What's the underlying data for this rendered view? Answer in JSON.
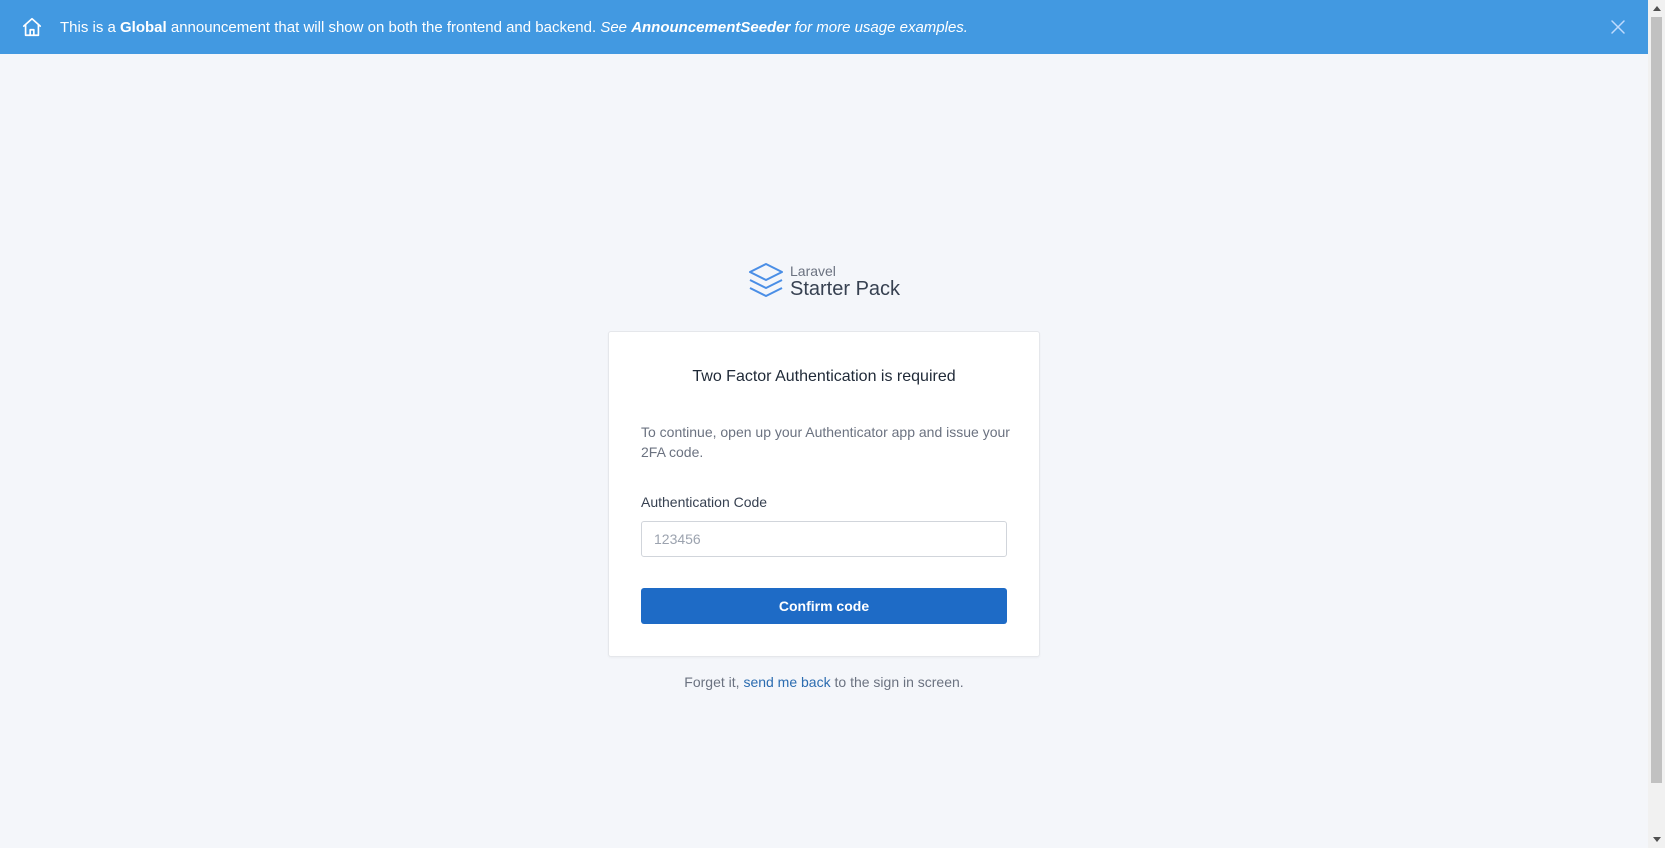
{
  "announcement": {
    "prefix": "This is a ",
    "bold_word": "Global",
    "middle": " announcement that will show on both the frontend and backend. ",
    "italic_prefix": "See ",
    "italic_bold": "AnnouncementSeeder",
    "italic_suffix": " for more usage examples.",
    "icon": "home-icon",
    "close_icon": "close-icon",
    "bg_color": "#4299e1"
  },
  "logo": {
    "small": "Laravel",
    "big": "Starter Pack",
    "icon": "layers-icon"
  },
  "card": {
    "title": "Two Factor Authentication is required",
    "description": "To continue, open up your Authenticator app and issue your 2FA code.",
    "code_label": "Authentication Code",
    "code_placeholder": "123456",
    "code_value": "",
    "confirm_label": "Confirm code"
  },
  "footer": {
    "prefix": "Forget it, ",
    "link": "send me back",
    "suffix": " to the sign in screen."
  },
  "colors": {
    "primary": "#1e6bc6",
    "link": "#2b6cb0",
    "background": "#f4f6fa"
  }
}
